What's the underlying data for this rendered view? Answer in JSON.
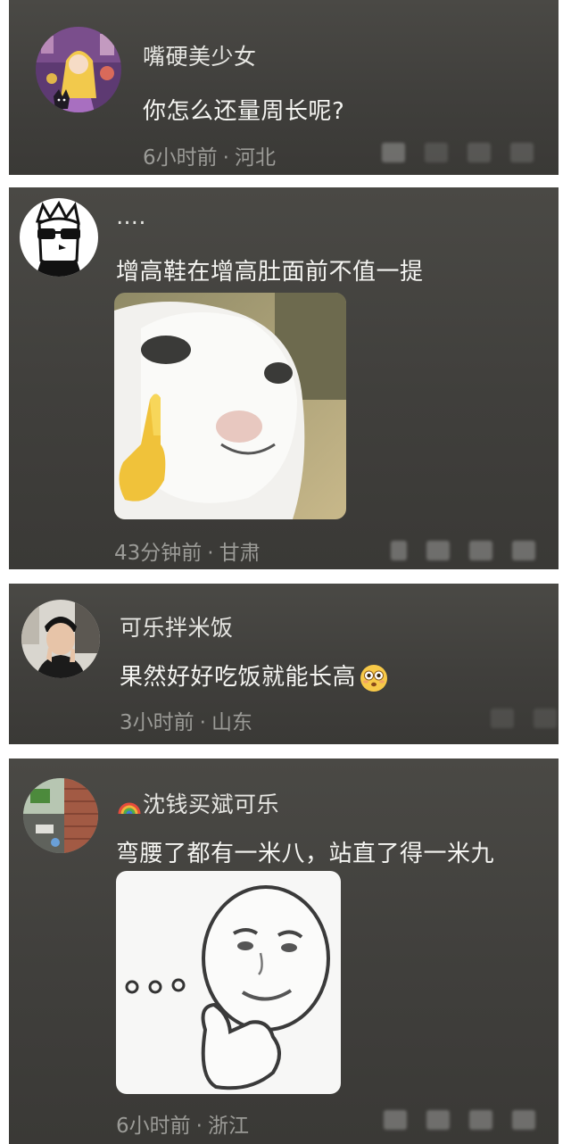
{
  "comments": [
    {
      "username": "嘴硬美少女",
      "text": "你怎么还量周长呢?",
      "time": "6小时前",
      "location": "河北",
      "avatar_icon": "anime-girl-avatar-icon"
    },
    {
      "username": "….",
      "text": "增高鞋在增高肚面前不值一提",
      "time": "43分钟前",
      "location": "甘肃",
      "avatar_icon": "cartoon-dog-sunglasses-avatar-icon",
      "sticker": "cat-pointing-up-sticker"
    },
    {
      "username": "可乐拌米饭",
      "text": "果然好好吃饭就能长高",
      "time": "3小时前",
      "location": "山东",
      "avatar_icon": "person-photo-avatar-icon",
      "emoji": "flushed-face-emoji"
    },
    {
      "username": "沈钱买斌可乐",
      "text": "弯腰了都有一米八，站直了得一米九",
      "time": "6小时前",
      "location": "浙江",
      "avatar_icon": "room-photo-avatar-icon",
      "username_prefix_icon": "rainbow-icon",
      "sticker": "thinking-face-sticker"
    }
  ],
  "separator": "·",
  "colors": {
    "card_background": "#434240",
    "username": "#e6e6e2",
    "comment_text": "#f4f4f1",
    "meta_text": "#9b9b97"
  }
}
